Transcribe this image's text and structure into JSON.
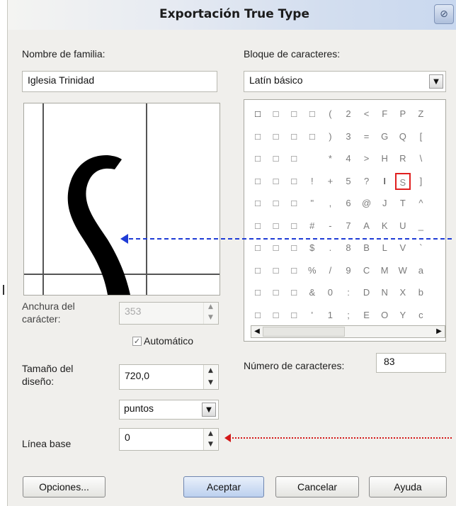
{
  "dialog": {
    "title": "Exportación True Type",
    "close_icon": "close-icon"
  },
  "family": {
    "label": "Nombre de familia:",
    "value": "Iglesia Trinidad"
  },
  "block": {
    "label": "Bloque de caracteres:",
    "selected": "Latín básico"
  },
  "preview": {
    "glyph": "S"
  },
  "char_grid": {
    "rows": [
      [
        "□",
        "□",
        "□",
        "□",
        "(",
        "2",
        "<",
        "F",
        "P",
        "Z"
      ],
      [
        "□",
        "□",
        "□",
        "□",
        ")",
        "3",
        "=",
        "G",
        "Q",
        "["
      ],
      [
        "□",
        "□",
        "□",
        "",
        "*",
        "4",
        ">",
        "H",
        "R",
        "\\"
      ],
      [
        "□",
        "□",
        "□",
        "!",
        "+",
        "5",
        "?",
        "I",
        "S",
        "]"
      ],
      [
        "□",
        "□",
        "□",
        "\"",
        ",",
        "6",
        "@",
        "J",
        "T",
        "^"
      ],
      [
        "□",
        "□",
        "□",
        "#",
        "-",
        "7",
        "A",
        "K",
        "U",
        "_"
      ],
      [
        "□",
        "□",
        "□",
        "$",
        ".",
        "8",
        "B",
        "L",
        "V",
        "`"
      ],
      [
        "□",
        "□",
        "□",
        "%",
        "/",
        "9",
        "C",
        "M",
        "W",
        "a"
      ],
      [
        "□",
        "□",
        "□",
        "&",
        "0",
        ":",
        "D",
        "N",
        "X",
        "b"
      ],
      [
        "□",
        "□",
        "□",
        "'",
        "1",
        ";",
        "E",
        "O",
        "Y",
        "c"
      ]
    ],
    "selected_char": "S"
  },
  "char_width": {
    "label_line1": "Anchura del",
    "label_line2": "carácter:",
    "value": "353"
  },
  "automatic": {
    "label": "Automático",
    "checked": true
  },
  "design_size": {
    "label_line1": "Tamaño del",
    "label_line2": "diseño:",
    "value": "720,0"
  },
  "units": {
    "selected": "puntos"
  },
  "baseline": {
    "label": "Línea base",
    "value": "0"
  },
  "char_count": {
    "label": "Número de caracteres:",
    "value": "83"
  },
  "buttons": {
    "options": "Opciones...",
    "accept": "Aceptar",
    "cancel": "Cancelar",
    "help": "Ayuda"
  },
  "colors": {
    "annotation_blue": "#1f3cd6",
    "annotation_red": "#d41818",
    "selection_red": "#e02020"
  }
}
